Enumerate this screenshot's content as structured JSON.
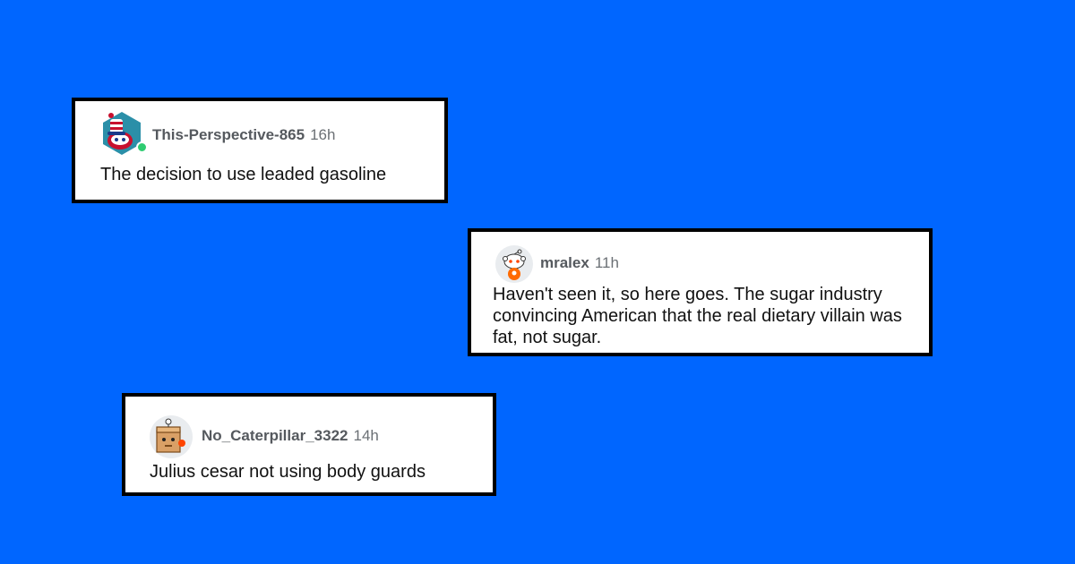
{
  "comments": [
    {
      "username": "This-Perspective-865",
      "time": "16h",
      "text": "The decision to use leaded gasoline",
      "avatar": "snoo-hat-avatar-icon",
      "online": true
    },
    {
      "username": "mralex",
      "time": "11h",
      "text": "Haven't seen it, so here goes. The sugar industry convincing American that the real dietary villain was fat, not sugar.",
      "avatar": "snoo-default-avatar-icon",
      "online": false
    },
    {
      "username": "No_Caterpillar_3322",
      "time": "14h",
      "text": "Julius cesar not using body guards",
      "avatar": "snoo-box-avatar-icon",
      "online": false
    }
  ],
  "colors": {
    "background": "#0066ff",
    "card": "#ffffff",
    "border": "#000000",
    "online": "#2ecc71"
  }
}
